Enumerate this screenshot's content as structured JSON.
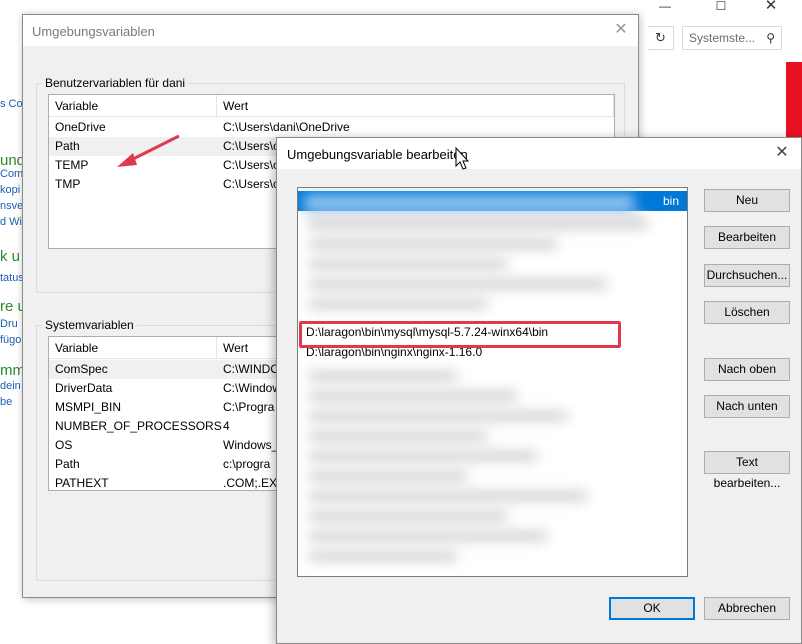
{
  "background": {
    "search_placeholder": "Systemste...",
    "left_strip": [
      {
        "text": "s Co",
        "style": "blue"
      },
      {
        "text": "und",
        "style": "green"
      },
      {
        "text": "Com",
        "style": "blue"
      },
      {
        "text": "kopi",
        "style": "blue"
      },
      {
        "text": "nsve",
        "style": "blue"
      },
      {
        "text": "d Wi",
        "style": "blue"
      },
      {
        "text": "k u",
        "style": "green"
      },
      {
        "text": "tatus",
        "style": "gray"
      },
      {
        "text": "re u",
        "style": "green"
      },
      {
        "text": "Dru",
        "style": "blue"
      },
      {
        "text": "fügo",
        "style": "blue"
      },
      {
        "text": "mme",
        "style": "green"
      },
      {
        "text": "dein",
        "style": "blue"
      },
      {
        "text": "be",
        "style": "blue"
      }
    ]
  },
  "env_dialog": {
    "title": "Umgebungsvariablen",
    "user_group_label": "Benutzervariablen für dani",
    "system_group_label": "Systemvariablen",
    "columns": {
      "variable": "Variable",
      "value": "Wert"
    },
    "user_vars": [
      {
        "name": "OneDrive",
        "value": "C:\\Users\\dani\\OneDrive"
      },
      {
        "name": "Path",
        "value": "C:\\Users\\c"
      },
      {
        "name": "TEMP",
        "value": "C:\\Users\\c"
      },
      {
        "name": "TMP",
        "value": "C:\\Users\\c"
      }
    ],
    "system_vars": [
      {
        "name": "ComSpec",
        "value": "C:\\WINDO"
      },
      {
        "name": "DriverData",
        "value": "C:\\Window"
      },
      {
        "name": "MSMPI_BIN",
        "value": "C:\\Progra"
      },
      {
        "name": "NUMBER_OF_PROCESSORS",
        "value": "4"
      },
      {
        "name": "OS",
        "value": "Windows_"
      },
      {
        "name": "Path",
        "value": "c:\\progra"
      },
      {
        "name": "PATHEXT",
        "value": ".COM;.EXE"
      }
    ]
  },
  "edit_dialog": {
    "title": "Umgebungsvariable bearbeiten",
    "selected_suffix": "bin",
    "path_entries": [
      "D:\\laragon\\bin\\mysql\\mysql-5.7.24-winx64\\bin",
      "D:\\laragon\\bin\\nginx\\nginx-1.16.0"
    ],
    "buttons": {
      "new": "Neu",
      "edit": "Bearbeiten",
      "browse": "Durchsuchen...",
      "delete": "Löschen",
      "move_up": "Nach oben",
      "move_down": "Nach unten",
      "edit_text": "Text bearbeiten...",
      "ok": "OK",
      "cancel": "Abbrechen"
    }
  },
  "colors": {
    "selection": "#0078d7",
    "highlight_box": "#e0394b",
    "arrow": "#e0394b"
  }
}
